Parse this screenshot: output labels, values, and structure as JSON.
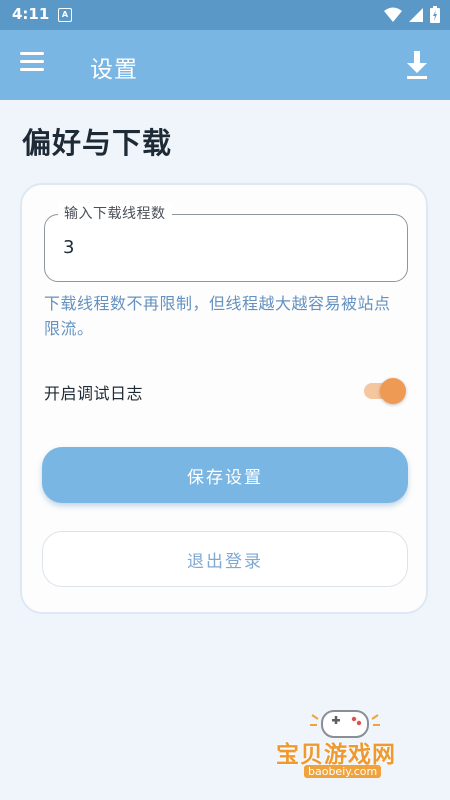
{
  "status_bar": {
    "time": "4:11",
    "notification_glyph": "A",
    "icons": [
      "wifi-icon",
      "signal-icon",
      "battery-icon"
    ]
  },
  "app_bar": {
    "title": "设置",
    "icons": [
      "menu-icon",
      "download-icon"
    ]
  },
  "page": {
    "title": "偏好与下载"
  },
  "settings": {
    "thread_field_label": "输入下载线程数",
    "thread_field_value": "3",
    "hint": "下载线程数不再限制，但线程越大越容易被站点限流。",
    "debug_log_label": "开启调试日志",
    "debug_log_enabled": true,
    "save_label": "保存设置",
    "logout_label": "退出登录"
  },
  "watermark": {
    "text": "宝贝游戏网",
    "url": "baobeiy.com"
  },
  "colors": {
    "status_bar": "#5a98c8",
    "app_bar": "#7ab6e3",
    "background": "#f0f5fb",
    "accent_orange": "#ee9a54",
    "hint_text": "#6592c0"
  }
}
